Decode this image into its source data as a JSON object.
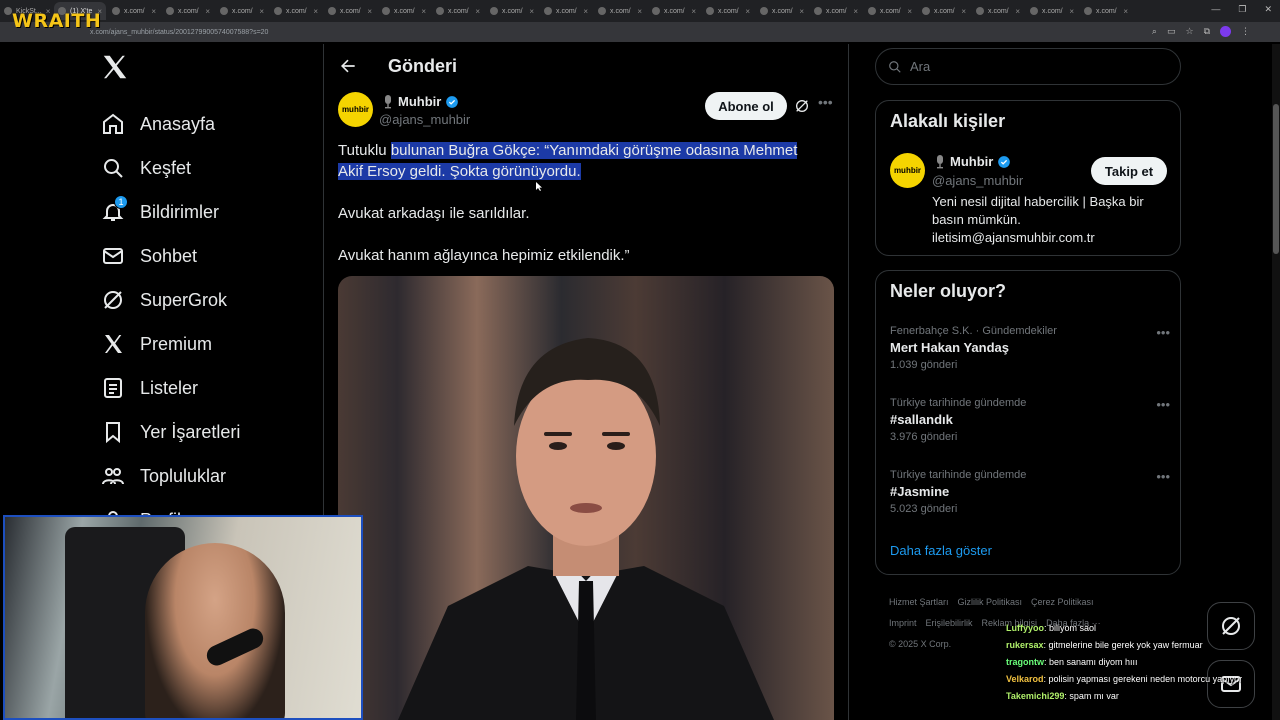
{
  "browser": {
    "tabs": [
      "KickSt...",
      "(1) X'te",
      "x.com/",
      "x.com/",
      "x.com/",
      "x.com/",
      "x.com/",
      "x.com/",
      "x.com/",
      "x.com/",
      "x.com/",
      "x.com/",
      "x.com/",
      "x.com/",
      "x.com/",
      "x.com/",
      "x.com/",
      "x.com/",
      "x.com/",
      "x.com/",
      "x.com/"
    ],
    "url": "x.com/ajans_muhbir/status/2001279900574007588?s=20",
    "overlay_logo": "WRAITH"
  },
  "nav": {
    "items": [
      {
        "label": "Anasayfa",
        "icon": "home-icon"
      },
      {
        "label": "Keşfet",
        "icon": "search-icon"
      },
      {
        "label": "Bildirimler",
        "icon": "bell-icon",
        "badge": "1"
      },
      {
        "label": "Sohbet",
        "icon": "mail-icon"
      },
      {
        "label": "SuperGrok",
        "icon": "grok-icon"
      },
      {
        "label": "Premium",
        "icon": "x-icon"
      },
      {
        "label": "Listeler",
        "icon": "list-icon"
      },
      {
        "label": "Yer İşaretleri",
        "icon": "bookmark-icon"
      },
      {
        "label": "Topluluklar",
        "icon": "people-icon"
      },
      {
        "label": "Profil",
        "icon": "person-icon"
      }
    ]
  },
  "post": {
    "header_title": "Gönderi",
    "author_name": "Muhbir",
    "author_handle": "@ajans_muhbir",
    "avatar_text": "muhbir",
    "subscribe_label": "Abone ol",
    "text_prefix": "Tutuklu ",
    "text_highlighted": "bulunan Buğra Gökçe: “Yanımdaki görüşme odasına Mehmet Akif Ersoy geldi. Şokta görünüyordu.",
    "paragraph2": "Avukat arkadaşı ile sarıldılar.",
    "paragraph3": "Avukat hanım ağlayınca hepimiz etkilendik.”"
  },
  "right": {
    "search_placeholder": "Ara",
    "related": {
      "title": "Alakalı kişiler",
      "name": "Muhbir",
      "handle": "@ajans_muhbir",
      "follow_label": "Takip et",
      "bio": "Yeni nesil dijital habercilik | Başka bir basın mümkün. iletisim@ajansmuhbir.com.tr"
    },
    "trends": {
      "title": "Neler oluyor?",
      "items": [
        {
          "context": "Fenerbahçe S.K. · Gündemdekiler",
          "name": "Mert Hakan Yandaş",
          "count": "1.039 gönderi"
        },
        {
          "context": "Türkiye tarihinde gündemde",
          "name": "#sallandık",
          "count": "3.976 gönderi"
        },
        {
          "context": "Türkiye tarihinde gündemde",
          "name": "#Jasmine",
          "count": "5.023 gönderi"
        }
      ],
      "show_more": "Daha fazla göster"
    },
    "footer": [
      "Hizmet Şartları",
      "Gizlilik Politikası",
      "Çerez Politikası",
      "Imprint",
      "Erişilebilirlik",
      "Reklam bilgisi",
      "Daha fazla ···",
      "© 2025 X Corp."
    ]
  },
  "chat": [
    {
      "user": "Luffyyoo",
      "text": ": biliyom saol"
    },
    {
      "user": "rukersax",
      "text": ": gitmelerine bile gerek yok yaw fermuar"
    },
    {
      "user": "tragontw",
      "text": ": ben sanamı diyom hııı"
    },
    {
      "user": "Velkarod",
      "text": ": polisin yapması gerekeni neden motorcu yapıyor"
    },
    {
      "user": "Takemichi299",
      "text": ": spam mı var"
    }
  ],
  "colors": {
    "accent": "#1d9bf0",
    "highlight": "#1c3aa6",
    "avatar_yellow": "#f5d400"
  }
}
